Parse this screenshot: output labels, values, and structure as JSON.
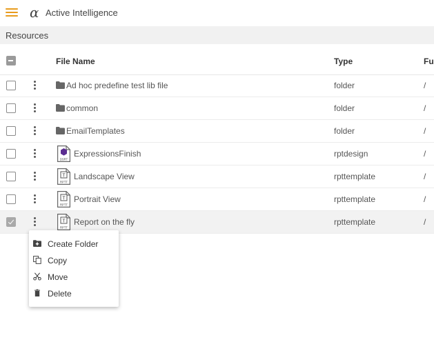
{
  "app": {
    "logo_glyph": "α",
    "title": "Active Intelligence"
  },
  "breadcrumb": {
    "label": "Resources"
  },
  "table": {
    "columns": {
      "name": "File Name",
      "type": "Type",
      "folder": "Fu"
    },
    "rows": [
      {
        "name": "Ad hoc predefine test lib file",
        "type": "folder",
        "folder": "/",
        "icon": "folder-icon",
        "checked": false
      },
      {
        "name": "common",
        "type": "folder",
        "folder": "/",
        "icon": "folder-icon",
        "checked": false
      },
      {
        "name": "EmailTemplates",
        "type": "folder",
        "folder": "/",
        "icon": "folder-icon",
        "checked": false
      },
      {
        "name": "ExpressionsFinish",
        "type": "rptdesign",
        "folder": "/",
        "icon": "rptdesign-file-icon",
        "icon_tag": "DSRT",
        "checked": false
      },
      {
        "name": "Landscape View",
        "type": "rpttemplate",
        "folder": "/",
        "icon": "rpttemplate-file-icon",
        "icon_tag": "RPTT",
        "checked": false
      },
      {
        "name": "Portrait View",
        "type": "rpttemplate",
        "folder": "/",
        "icon": "rpttemplate-file-icon",
        "icon_tag": "RPTT",
        "checked": false
      },
      {
        "name": "Report on the fly",
        "type": "rpttemplate",
        "folder": "/",
        "icon": "rpttemplate-file-icon",
        "icon_tag": "RPTT",
        "checked": true
      }
    ]
  },
  "context_menu": {
    "items": [
      {
        "label": "Create Folder",
        "icon": "create-folder-icon"
      },
      {
        "label": "Copy",
        "icon": "copy-icon"
      },
      {
        "label": "Move",
        "icon": "scissors-icon"
      },
      {
        "label": "Delete",
        "icon": "trash-icon"
      }
    ]
  },
  "colors": {
    "accent": "#e89b1c",
    "rptdesign_badge": "#5b2d91",
    "selected_row": "#f2f2f2"
  }
}
